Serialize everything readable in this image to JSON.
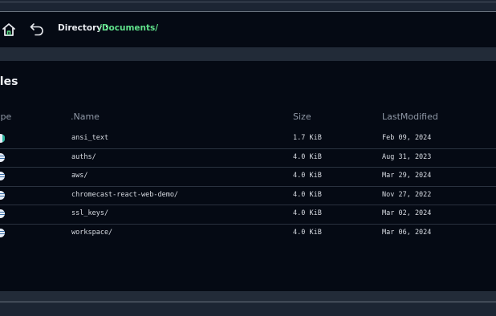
{
  "header": {
    "directory_label": "Directory :",
    "directory_path": "/Documents/",
    "home_icon": "home-icon",
    "back_icon": "undo-arrow-icon"
  },
  "section": {
    "title": "iles"
  },
  "table": {
    "columns": {
      "type": "ype",
      "name": ".Name",
      "size": "Size",
      "modified": "LastModified"
    },
    "rows": [
      {
        "icon": "file-icon",
        "name": "ansi_text",
        "size": "1.7 KiB",
        "modified": "Feb 09, 2024"
      },
      {
        "icon": "folder-icon",
        "name": "auths/",
        "size": "4.0 KiB",
        "modified": "Aug 31, 2023"
      },
      {
        "icon": "folder-icon",
        "name": "aws/",
        "size": "4.0 KiB",
        "modified": "Mar 29, 2024"
      },
      {
        "icon": "folder-icon",
        "name": "chromecast-react-web-demo/",
        "size": "4.0 KiB",
        "modified": "Nov 27, 2022"
      },
      {
        "icon": "folder-icon",
        "name": "ssl_keys/",
        "size": "4.0 KiB",
        "modified": "Mar 02, 2024"
      },
      {
        "icon": "folder-icon",
        "name": "workspace/",
        "size": "4.0 KiB",
        "modified": "Mar 06, 2024"
      }
    ]
  },
  "colors": {
    "background": "#050a14",
    "band": "#222b38",
    "path_accent": "#5fe08a",
    "muted_header": "#8f98a6"
  }
}
